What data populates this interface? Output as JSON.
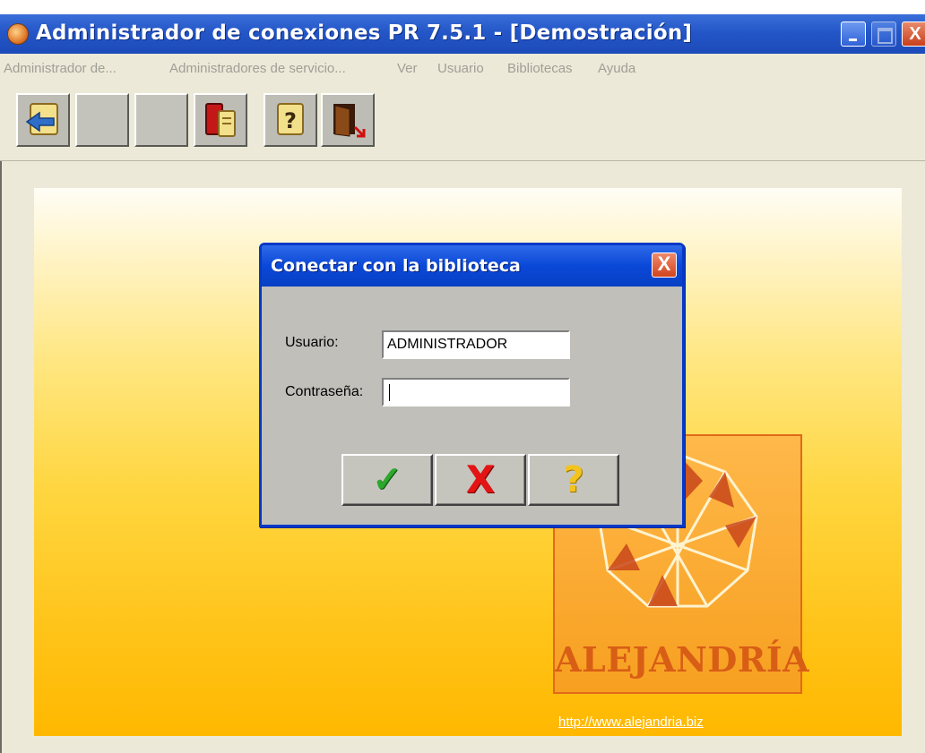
{
  "window": {
    "title": "Administrador de conexiones PR 7.5.1 - [Demostración]",
    "close_glyph": "X"
  },
  "menu": {
    "items": [
      "Administrador de...",
      "Administradores de servicio...",
      "Ver",
      "Usuario",
      "Bibliotecas",
      "Ayuda"
    ]
  },
  "toolbar": {
    "buttons": [
      {
        "icon": "connect-scroll-icon",
        "enabled": true
      },
      {
        "icon": "blank",
        "enabled": false
      },
      {
        "icon": "blank",
        "enabled": false
      },
      {
        "icon": "library-books-icon",
        "enabled": true
      },
      {
        "icon": "help-scroll-icon",
        "enabled": true
      },
      {
        "icon": "exit-door-icon",
        "enabled": true
      }
    ]
  },
  "dialog": {
    "title": "Conectar con la biblioteca",
    "close_glyph": "X",
    "user_label": "Usuario:",
    "user_value": "ADMINISTRADOR",
    "password_label": "Contraseña:",
    "password_value": "",
    "ok_glyph": "✓",
    "cancel_glyph": "X",
    "help_glyph": "?"
  },
  "brand": {
    "logo_text": "ALEJANDRÍA",
    "link": "http://www.alejandria.biz",
    "colors": {
      "logo_orange": "#e06a1a",
      "gradient_gold": "#ffc41a"
    }
  }
}
